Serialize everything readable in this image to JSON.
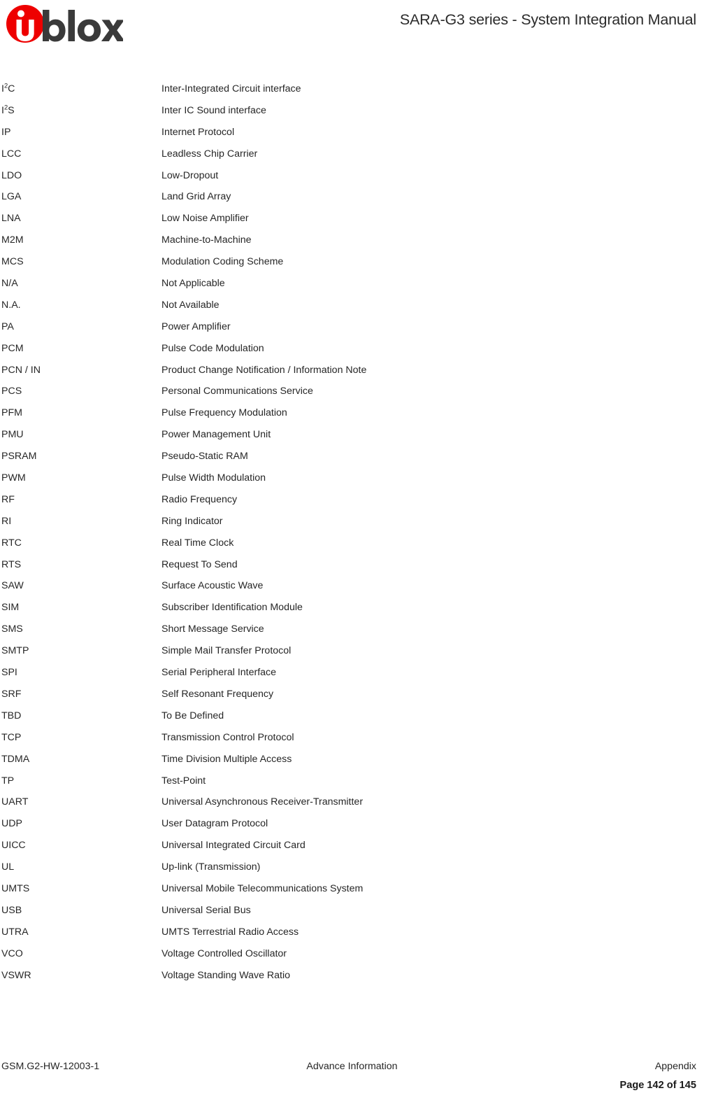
{
  "header": {
    "logo_alt": "u-blox",
    "logo_word": "blox",
    "logo_red": "#EE0000",
    "logo_dark": "#3A3A3A",
    "title": "SARA-G3 series - System Integration Manual"
  },
  "glossary": {
    "rows": [
      {
        "term": "I2C",
        "term_base": "I",
        "term_sup": "2",
        "term_tail": "C",
        "definition": "Inter-Integrated Circuit interface"
      },
      {
        "term": "I2S",
        "term_base": "I",
        "term_sup": "2",
        "term_tail": "S",
        "definition": "Inter IC Sound interface"
      },
      {
        "term": "IP",
        "definition": "Internet Protocol"
      },
      {
        "term": "LCC",
        "definition": "Leadless Chip Carrier"
      },
      {
        "term": "LDO",
        "definition": "Low-Dropout"
      },
      {
        "term": "LGA",
        "definition": "Land Grid Array"
      },
      {
        "term": "LNA",
        "definition": "Low Noise Amplifier"
      },
      {
        "term": "M2M",
        "definition": "Machine-to-Machine"
      },
      {
        "term": "MCS",
        "definition": "Modulation Coding Scheme"
      },
      {
        "term": "N/A",
        "definition": "Not Applicable"
      },
      {
        "term": "N.A.",
        "definition": "Not Available"
      },
      {
        "term": "PA",
        "definition": "Power Amplifier"
      },
      {
        "term": "PCM",
        "definition": "Pulse Code Modulation"
      },
      {
        "term": "PCN / IN",
        "definition": "Product Change Notification / Information Note"
      },
      {
        "term": "PCS",
        "definition": "Personal Communications Service"
      },
      {
        "term": "PFM",
        "definition": "Pulse Frequency Modulation"
      },
      {
        "term": "PMU",
        "definition": "Power Management Unit"
      },
      {
        "term": "PSRAM",
        "definition": "Pseudo-Static RAM"
      },
      {
        "term": "PWM",
        "definition": "Pulse Width Modulation"
      },
      {
        "term": "RF",
        "definition": "Radio Frequency"
      },
      {
        "term": "RI",
        "definition": "Ring Indicator"
      },
      {
        "term": "RTC",
        "definition": "Real Time Clock"
      },
      {
        "term": "RTS",
        "definition": "Request To Send"
      },
      {
        "term": "SAW",
        "definition": "Surface Acoustic Wave"
      },
      {
        "term": "SIM",
        "definition": "Subscriber Identification Module"
      },
      {
        "term": "SMS",
        "definition": "Short Message Service"
      },
      {
        "term": "SMTP",
        "definition": "Simple Mail Transfer Protocol"
      },
      {
        "term": "SPI",
        "definition": "Serial Peripheral Interface"
      },
      {
        "term": "SRF",
        "definition": "Self Resonant Frequency"
      },
      {
        "term": "TBD",
        "definition": "To Be Defined"
      },
      {
        "term": "TCP",
        "definition": "Transmission Control Protocol"
      },
      {
        "term": "TDMA",
        "definition": "Time Division Multiple Access"
      },
      {
        "term": "TP",
        "definition": "Test-Point"
      },
      {
        "term": "UART",
        "definition": "Universal Asynchronous Receiver-Transmitter"
      },
      {
        "term": "UDP",
        "definition": "User Datagram Protocol"
      },
      {
        "term": "UICC",
        "definition": "Universal Integrated Circuit Card"
      },
      {
        "term": "UL",
        "definition": "Up-link (Transmission)"
      },
      {
        "term": "UMTS",
        "definition": "Universal Mobile Telecommunications System"
      },
      {
        "term": "USB",
        "definition": "Universal Serial Bus"
      },
      {
        "term": "UTRA",
        "definition": "UMTS Terrestrial Radio Access"
      },
      {
        "term": "VCO",
        "definition": "Voltage Controlled Oscillator"
      },
      {
        "term": "VSWR",
        "definition": "Voltage Standing Wave Ratio"
      }
    ]
  },
  "footer": {
    "doc_number": "GSM.G2-HW-12003-1",
    "status": "Advance Information",
    "section": "Appendix",
    "page_label": "Page 142 of 145"
  }
}
